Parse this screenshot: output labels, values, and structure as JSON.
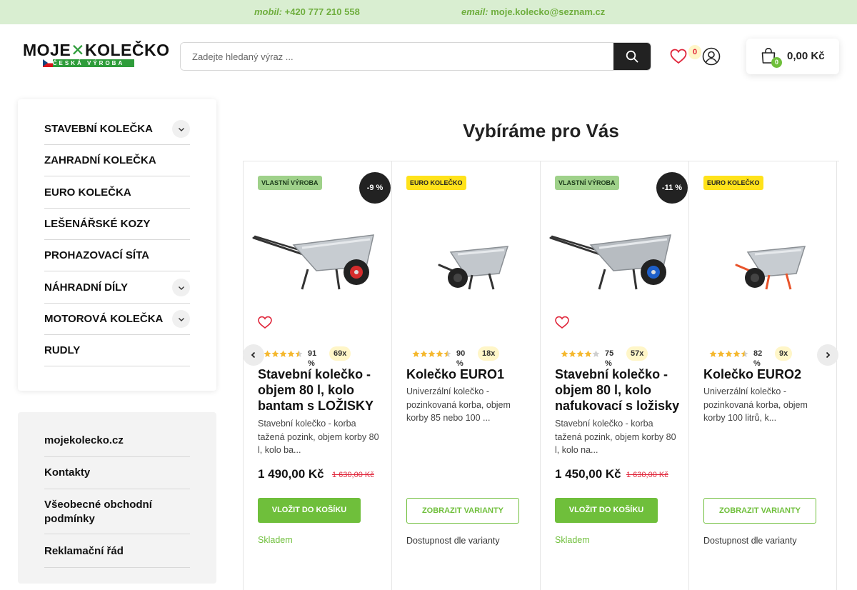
{
  "topbar": {
    "phone_label": "mobil:",
    "phone": "+420 777 210 558",
    "email_label": "email:",
    "email": "moje.kolecko@seznam.cz"
  },
  "logo": {
    "word_left": "MOJE",
    "word_right": "KOLEČKO",
    "sub": "ČESKÁ VÝROBA"
  },
  "search": {
    "placeholder": "Zadejte hledaný výraz ..."
  },
  "header": {
    "wishlist_count": "0",
    "cart_count": "0",
    "cart_total": "0,00 Kč"
  },
  "categories": [
    {
      "label": "STAVEBNÍ KOLEČKA",
      "expandable": true
    },
    {
      "label": "ZAHRADNÍ KOLEČKA",
      "expandable": false
    },
    {
      "label": "EURO KOLEČKA",
      "expandable": false
    },
    {
      "label": "LEŠENÁŘSKÉ KOZY",
      "expandable": false
    },
    {
      "label": "PROHAZOVACÍ SÍTA",
      "expandable": false
    },
    {
      "label": "NÁHRADNÍ DÍLY",
      "expandable": true
    },
    {
      "label": "MOTOROVÁ KOLEČKA",
      "expandable": true
    },
    {
      "label": "RUDLY",
      "expandable": false
    }
  ],
  "info_links": [
    "mojekolecko.cz",
    "Kontakty",
    "Všeobecné obchodní podmínky",
    "Reklamační řád"
  ],
  "section_title": "Vybíráme pro Vás",
  "products": [
    {
      "tag": "VLASTNÍ VÝROBA",
      "discount": "-9 %",
      "rating_percent": "91 %",
      "rating_stars": 4.5,
      "review_count": "69x",
      "name": "Stavební kolečko - objem 80 l, kolo bantam s LOŽISKY",
      "desc": "Stavební kolečko - korba tažená pozink, objem korby 80 l, kolo ba...",
      "price": "1 490,00 Kč",
      "old_price": "1 630,00 Kč",
      "button": "VLOŽIT DO KOŠÍKU",
      "availability": "Skladem"
    },
    {
      "tag": "EURO KOLEČKO",
      "discount": "",
      "rating_percent": "90 %",
      "rating_stars": 4.5,
      "review_count": "18x",
      "name": "Kolečko EURO1",
      "desc": "Univerzální kolečko - pozinkovaná korba, objem korby 85 nebo 100 ...",
      "price": "",
      "old_price": "",
      "button": "ZOBRAZIT VARIANTY",
      "availability": "Dostupnost dle varianty"
    },
    {
      "tag": "VLASTNÍ VÝROBA",
      "discount": "-11 %",
      "rating_percent": "75 %",
      "rating_stars": 4,
      "review_count": "57x",
      "name": "Stavební kolečko - objem 80 l, kolo nafukovací s ložisky",
      "desc": "Stavební kolečko - korba tažená pozink, objem korby 80 l, kolo na...",
      "price": "1 450,00 Kč",
      "old_price": "1 630,00 Kč",
      "button": "VLOŽIT DO KOŠÍKU",
      "availability": "Skladem"
    },
    {
      "tag": "EURO KOLEČKO",
      "discount": "",
      "rating_percent": "82 %",
      "rating_stars": 4.5,
      "review_count": "9x",
      "name": "Kolečko EURO2",
      "desc": "Univerzální kolečko - pozinkovaná korba, objem korby 100 litrů, k...",
      "price": "",
      "old_price": "",
      "button": "ZOBRAZIT VARIANTY",
      "availability": "Dostupnost dle varianty"
    }
  ],
  "colors": {
    "accent_green": "#6fbf3b",
    "topbar_bg": "#d9eed1",
    "badge_own": "#9fd18a",
    "badge_euro": "#ffe21a",
    "sale_red": "#e0253a",
    "star": "#f5b82e"
  },
  "icons": {
    "search_button": "magnifier-icon",
    "wishlist": "heart-icon",
    "account": "user-icon",
    "cart": "shopping-bag-icon",
    "carousel_prev": "chevron-left-icon",
    "carousel_next": "chevron-right-icon"
  }
}
